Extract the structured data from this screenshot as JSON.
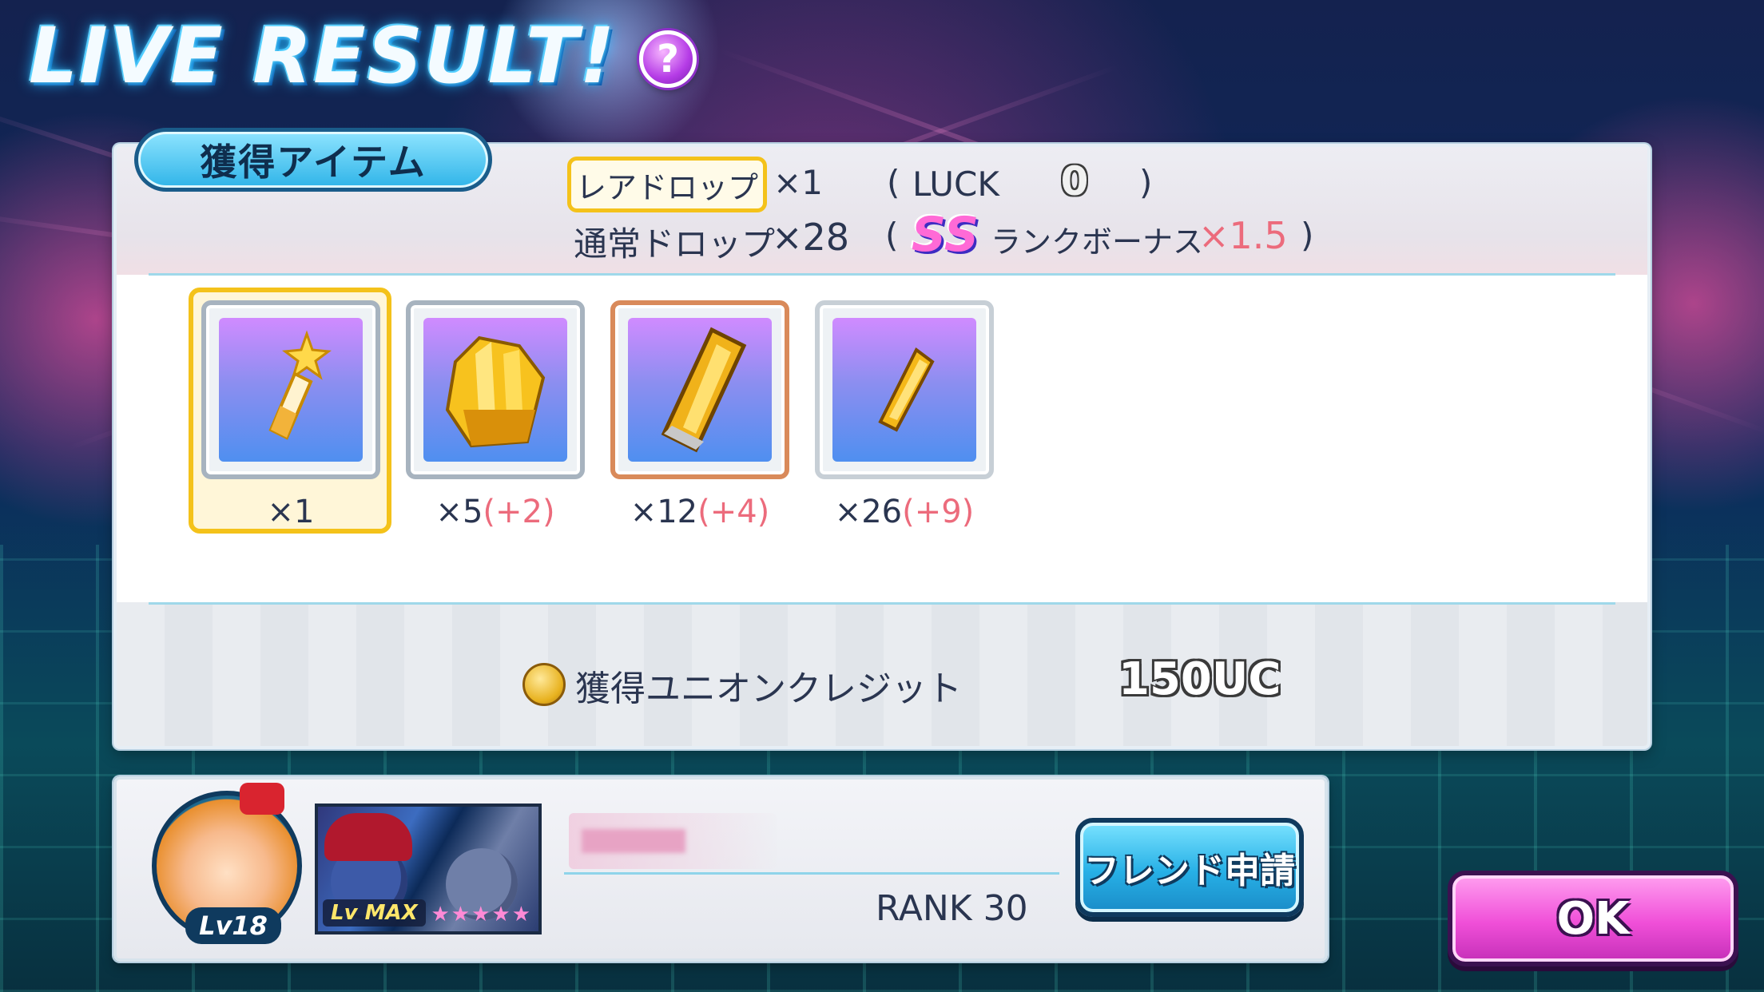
{
  "header": {
    "title": "LIVE RESULT!",
    "help_icon": "?"
  },
  "result": {
    "section_label": "獲得アイテム",
    "rare_drop_label": "レアドロップ",
    "rare_drop_count": "×1",
    "luck_open": "(",
    "luck_label": "LUCK",
    "luck_value": "0",
    "luck_close": ")",
    "normal_drop_label": "通常ドロップ",
    "normal_drop_count": "×28",
    "bonus_open": "(",
    "rank_badge": "SS",
    "bonus_label": "ランクボーナス",
    "bonus_multiplier": "×1.5",
    "bonus_close": ")",
    "items": [
      {
        "icon": "star-crystal-icon",
        "count": "×1",
        "bonus": ""
      },
      {
        "icon": "gold-crystal-cluster-icon",
        "count": "×5",
        "bonus": "(+2)"
      },
      {
        "icon": "gold-crystal-large-icon",
        "count": "×12",
        "bonus": "(+4)"
      },
      {
        "icon": "gold-crystal-shard-icon",
        "count": "×26",
        "bonus": "(+9)"
      }
    ],
    "uc_label": "獲得ユニオンクレジット",
    "uc_value": "150UC"
  },
  "friend": {
    "avatar_level": "Lv18",
    "card_level": "Lv MAX",
    "card_stars": "★★★★★",
    "rank": "RANK 30",
    "friend_button": "フレンド申請"
  },
  "ok_button": "OK",
  "colors": {
    "accent_blue": "#27b0e6",
    "accent_pink": "#f04fd8",
    "rare_gold": "#f4c21a",
    "bonus_red": "#ec6b7c"
  }
}
